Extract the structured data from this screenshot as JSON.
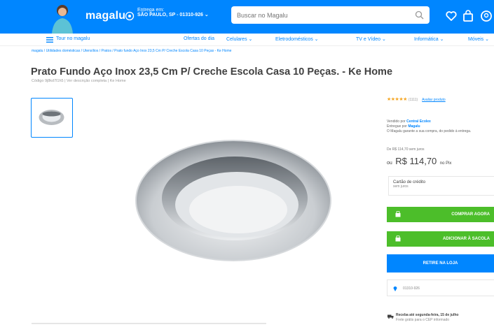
{
  "header": {
    "logo": "magalu",
    "delivery_line1": "Entrega em:",
    "delivery_line2": "SÃO PAULO, SP - 01310-926 ⌄",
    "search_placeholder": "Buscar no Magalu",
    "icons": [
      "search-icon",
      "heart-icon",
      "bag-icon",
      "user-icon"
    ],
    "brand_color": "#0086ff"
  },
  "nav": {
    "all": "Tour no magalu",
    "items": [
      "Ofertas do dia",
      "Celulares ⌄",
      "Eletrodomésticos ⌄",
      "TV e Vídeo ⌄",
      "Informática ⌄",
      "Móveis ⌄"
    ]
  },
  "breadcrumb": "magalu / Utilidades domésticas / Utensílios / Pratos / Prato fundo Aço Inox 23,5 Cm P/ Creche Escola Casa 10 Peças - Ke Home",
  "product": {
    "title": "Prato Fundo Aço Inox 23,5 Cm P/ Creche Escola Casa 10 Peças. - Ke Home",
    "subtitle": "Código 9j8kd7l1h5 | Ver descrição completa | Ke Home"
  },
  "sidebar": {
    "stars": "★★★★★",
    "rating_count": "(1111)",
    "rating_link": "Avaliar produto",
    "seller_line1": "Vendido por",
    "seller_name": "Central Ecolex",
    "seller_line2": "Entregue por",
    "seller_delivery": "Magalu",
    "seller_line3": "O Magalu garante a sua compra, do pedido à entrega.",
    "price_old": "De R$ 114,70 sem juros",
    "price_prefix": "ou",
    "price": "R$ 114,70",
    "price_suffix": "no Pix",
    "card_title": "Cartão de crédito",
    "card_sub": "sem juros",
    "buy_now": "COMPRAR AGORA",
    "add_bag": "ADICIONAR À SACOLA",
    "pickup": "RETIRE NA LOJA",
    "cep": "01310-926",
    "shipping_line1": "Receba até segunda-feira, 15 de julho",
    "shipping_line2": "Frete grátis para o CEP informado"
  },
  "colors": {
    "accent": "#0086ff",
    "buy": "#4cbe2a",
    "star": "#f5a623"
  }
}
